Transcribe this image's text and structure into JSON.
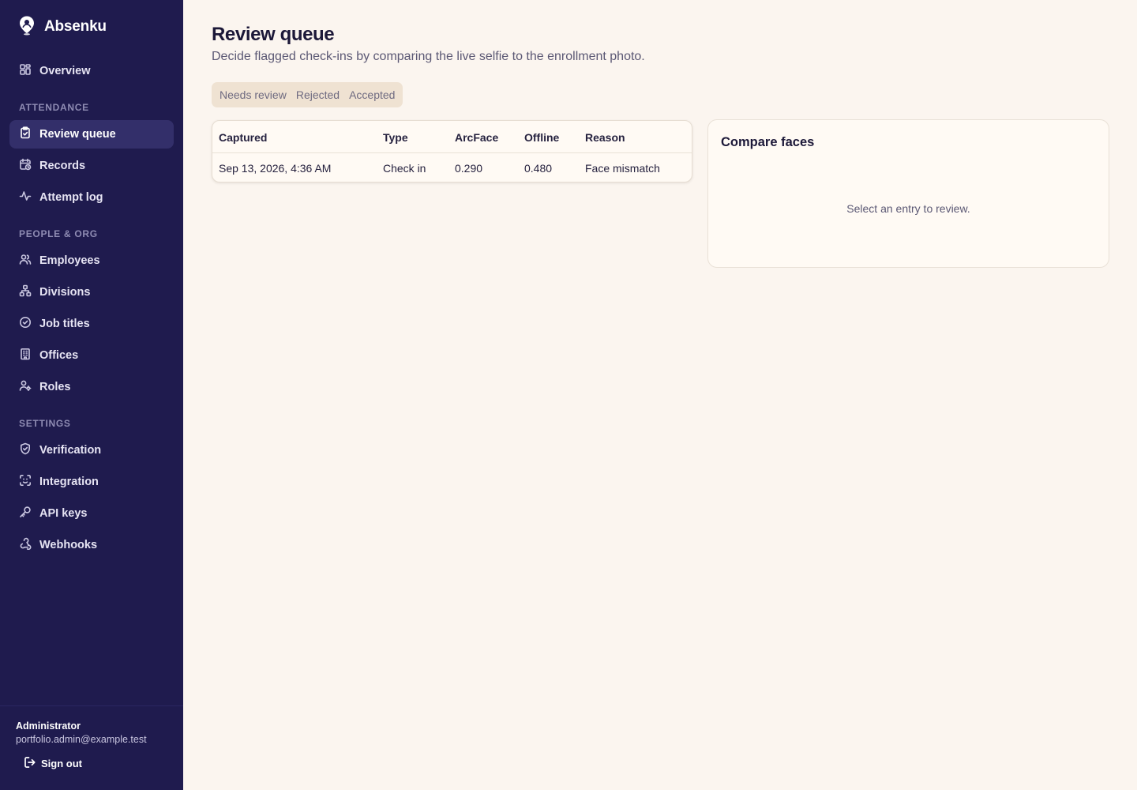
{
  "app": {
    "name": "Absenku"
  },
  "sidebar": {
    "overview": "Overview",
    "sections": {
      "attendance": "ATTENDANCE",
      "people_org": "PEOPLE & ORG",
      "settings": "SETTINGS"
    },
    "items": {
      "review_queue": "Review queue",
      "records": "Records",
      "attempt_log": "Attempt log",
      "employees": "Employees",
      "divisions": "Divisions",
      "job_titles": "Job titles",
      "offices": "Offices",
      "roles": "Roles",
      "verification": "Verification",
      "integration": "Integration",
      "api_keys": "API keys",
      "webhooks": "Webhooks"
    },
    "active_item": "Review queue"
  },
  "user": {
    "name": "Administrator",
    "email": "portfolio.admin@example.test",
    "signout": "Sign out"
  },
  "page": {
    "title": "Review queue",
    "subtitle": "Decide flagged check-ins by comparing the live selfie to the enrollment photo."
  },
  "tabs": [
    "Needs review",
    "Rejected",
    "Accepted"
  ],
  "table": {
    "columns": [
      "Captured",
      "Type",
      "ArcFace",
      "Offline",
      "Reason"
    ],
    "rows": [
      [
        "Sep 13, 2026, 4:36 AM",
        "Check in",
        "0.290",
        "0.480",
        "Face mismatch"
      ]
    ]
  },
  "compare": {
    "title": "Compare faces",
    "empty_message": "Select an entry to review."
  },
  "colors": {
    "sidebar_bg": "#1f1b4e",
    "sidebar_active": "#332f6a",
    "page_bg": "#fbf5ef",
    "card_bg": "#fffaf4",
    "tabs_bg": "#efe2d2"
  }
}
